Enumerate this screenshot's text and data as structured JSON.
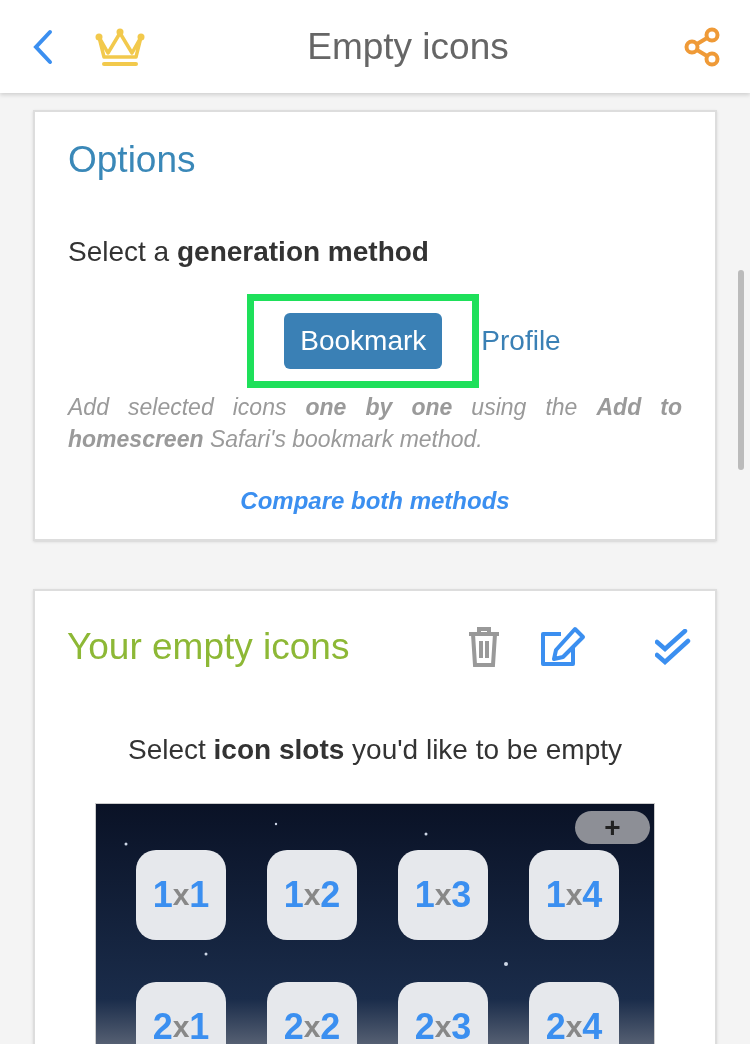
{
  "header": {
    "title": "Empty icons"
  },
  "options": {
    "title": "Options",
    "prompt": "Select a **generation method**",
    "methods": [
      {
        "label": "Bookmark",
        "selected": true,
        "highlighted": true
      },
      {
        "label": "Profile",
        "selected": false,
        "highlighted": false
      }
    ],
    "description": "Add selected icons **one by one** using the **Add to homescreen** Safari's bookmark method.",
    "compare_link": "Compare both methods"
  },
  "empty_icons": {
    "title": "Your empty icons",
    "prompt": "Select **icon slots** you'd like to be empty",
    "add_button": "+",
    "slots": [
      {
        "row": "1",
        "sep": "x",
        "col": "1"
      },
      {
        "row": "1",
        "sep": "x",
        "col": "2"
      },
      {
        "row": "1",
        "sep": "x",
        "col": "3"
      },
      {
        "row": "1",
        "sep": "x",
        "col": "4"
      },
      {
        "row": "2",
        "sep": "x",
        "col": "1"
      },
      {
        "row": "2",
        "sep": "x",
        "col": "2"
      },
      {
        "row": "2",
        "sep": "x",
        "col": "3"
      },
      {
        "row": "2",
        "sep": "x",
        "col": "4"
      }
    ]
  }
}
